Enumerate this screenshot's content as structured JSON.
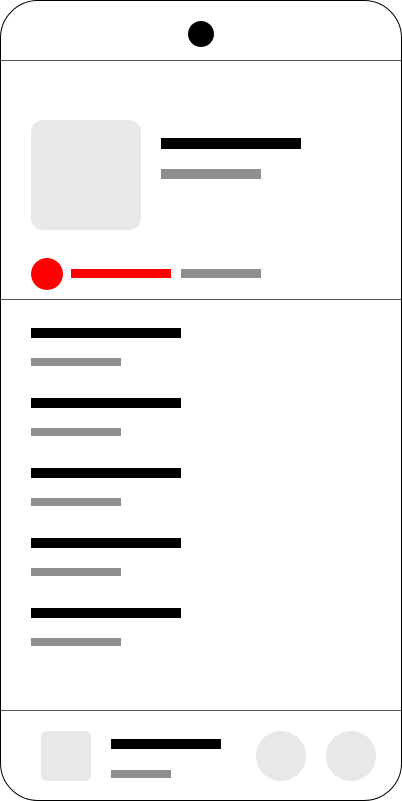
{
  "screen": {
    "type": "wireframe-music-player",
    "note_text_visible": false
  },
  "colors": {
    "frame": "#000000",
    "divider": "#555555",
    "placeholder": "#e8e8e8",
    "text_primary_bar": "#000000",
    "text_secondary_bar": "#8f8f8f",
    "accent": "#ff0000"
  },
  "header": {
    "artwork_icon": "image-placeholder",
    "title": "",
    "subtitle": "",
    "playback": {
      "play_icon": "record-dot",
      "progress_fraction": 0.5
    }
  },
  "tracklist": {
    "items": [
      {
        "title": "",
        "subtitle": ""
      },
      {
        "title": "",
        "subtitle": ""
      },
      {
        "title": "",
        "subtitle": ""
      },
      {
        "title": "",
        "subtitle": ""
      },
      {
        "title": "",
        "subtitle": ""
      }
    ]
  },
  "mini_player": {
    "thumbnail_icon": "image-placeholder",
    "title": "",
    "subtitle": "",
    "buttons": [
      {
        "icon": "circle-button"
      },
      {
        "icon": "circle-button"
      }
    ]
  }
}
